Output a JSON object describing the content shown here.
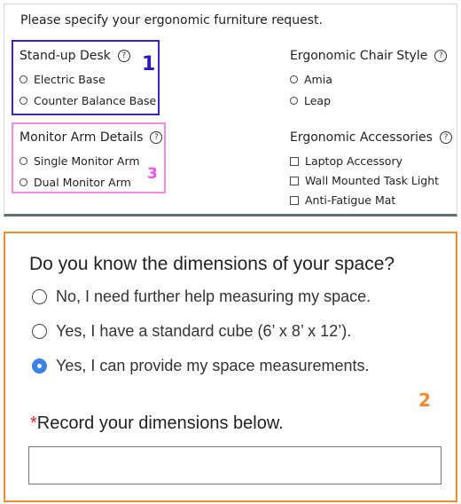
{
  "form": {
    "title": "Please specify your ergonomic furniture request.",
    "groups": {
      "standup_desk": {
        "title": "Stand-up Desk",
        "options": [
          "Electric Base",
          "Counter Balance Base"
        ]
      },
      "chair_style": {
        "title": "Ergonomic Chair Style",
        "options": [
          "Amia",
          "Leap"
        ]
      },
      "monitor_arm": {
        "title": "Monitor Arm Details",
        "options": [
          "Single Monitor Arm",
          "Dual Monitor Arm"
        ]
      },
      "accessories": {
        "title": "Ergonomic Accessories",
        "options": [
          "Laptop Accessory",
          "Wall Mounted Task Light",
          "Anti-Fatigue Mat"
        ]
      }
    },
    "help_glyph": "?"
  },
  "annotations": {
    "one": "1",
    "two": "2",
    "three": "3",
    "colors": {
      "one": "#2a17c4",
      "two": "#f18a2a",
      "three": "#f050e6"
    }
  },
  "dimensions": {
    "question": "Do you know the dimensions of your space?",
    "options": [
      "No, I need further help measuring my space.",
      "Yes, I have a standard cube (6’ x 8’ x 12’).",
      "Yes, I can provide my space measurements."
    ],
    "selected_index": 2,
    "record_label": "Record your dimensions below.",
    "required_marker": "*",
    "input_value": ""
  },
  "colors": {
    "accent": "#3c82e6",
    "required": "#dd2222"
  }
}
